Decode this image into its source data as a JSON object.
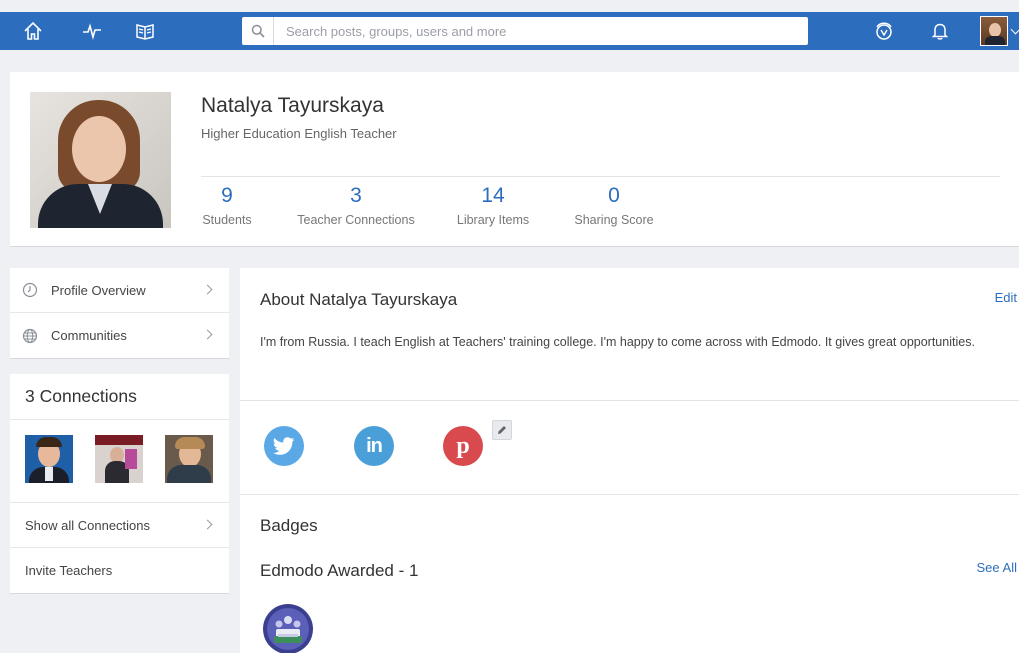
{
  "search": {
    "placeholder": "Search posts, groups, users and more"
  },
  "profile": {
    "name": "Natalya Tayurskaya",
    "title": "Higher Education English Teacher",
    "stats": [
      {
        "value": "9",
        "label": "Students"
      },
      {
        "value": "3",
        "label": "Teacher Connections"
      },
      {
        "value": "14",
        "label": "Library Items"
      },
      {
        "value": "0",
        "label": "Sharing Score"
      }
    ]
  },
  "sidebar": {
    "nav": [
      {
        "label": "Profile Overview",
        "icon": "clock-icon"
      },
      {
        "label": "Communities",
        "icon": "globe-icon"
      }
    ],
    "connections": {
      "title": "3 Connections",
      "show_all": "Show all Connections",
      "invite": "Invite Teachers"
    }
  },
  "about": {
    "title": "About Natalya Tayurskaya",
    "edit": "Edit",
    "text": "I'm from Russia. I teach English at Teachers' training college. I'm happy to come across with Edmodo. It gives great opportunities."
  },
  "badges": {
    "title": "Badges",
    "awarded": "Edmodo Awarded - 1",
    "see_all": "See All"
  },
  "colors": {
    "nav_bg": "#2c6ebd",
    "accent": "#2c6ebd",
    "twitter": "#5aa8e6",
    "linkedin": "#4a9fd8",
    "pinterest": "#d84a4e"
  }
}
